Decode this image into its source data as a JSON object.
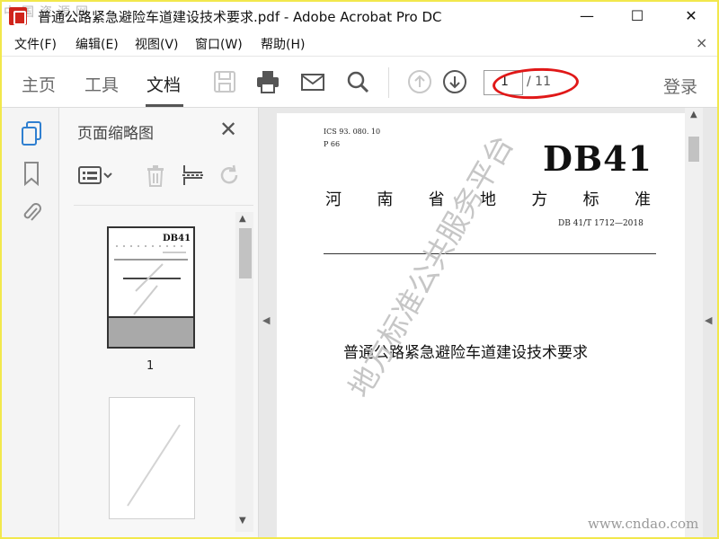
{
  "window": {
    "title": "普通公路紧急避险车道建设技术要求.pdf - Adobe Acrobat Pro DC",
    "min_glyph": "—",
    "max_glyph": "☐",
    "close_glyph": "✕"
  },
  "watermark_logo": "中国资源网",
  "menu": {
    "items": [
      "文件(F)",
      "编辑(E)",
      "视图(V)",
      "窗口(W)",
      "帮助(H)"
    ],
    "close_glyph": "×"
  },
  "toolbar": {
    "tabs": [
      "主页",
      "工具",
      "文档"
    ],
    "active_tab": "文档",
    "page_current": "1",
    "page_total": "/ 11",
    "login": "登录"
  },
  "thumbnails_panel": {
    "title": "页面缩略图",
    "close_glyph": "✕",
    "page_numbers": [
      "1"
    ]
  },
  "document": {
    "ics": "ICS  93. 080. 10",
    "p": "P  66",
    "db": "DB41",
    "standard_chars": [
      "河",
      "南",
      "省",
      "地",
      "方",
      "标",
      "准"
    ],
    "code": "DB 41/T  1712—2018",
    "title": "普通公路紧急避险车道建设技术要求",
    "watermark": "地方标准公共服务平台"
  },
  "site_watermark": "www.cndao.com",
  "colors": {
    "frame": "#f2e84c",
    "highlight_ellipse": "#e01818",
    "acrobat_red": "#d0241b"
  }
}
